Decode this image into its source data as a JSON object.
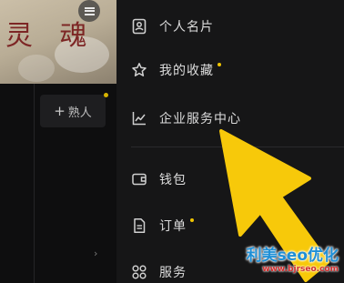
{
  "left_pane": {
    "cover_text": "灵 魂",
    "add_friend_plus": "+",
    "add_friend_label": "熟人",
    "chevron": "›"
  },
  "drawer": {
    "items": [
      {
        "label": "个人名片",
        "icon": "id-card-icon",
        "dot": false
      },
      {
        "label": "我的收藏",
        "icon": "star-icon",
        "dot": true
      },
      {
        "label": "企业服务中心",
        "icon": "chart-icon",
        "dot": false
      },
      {
        "label": "钱包",
        "icon": "wallet-icon",
        "dot": false
      },
      {
        "label": "订单",
        "icon": "order-icon",
        "dot": true
      },
      {
        "label": "服务",
        "icon": "services-icon",
        "dot": false
      }
    ]
  },
  "watermark": {
    "title": "利美seo优化",
    "url": "www.bjrseo.com"
  },
  "colors": {
    "drawer_bg": "#161617",
    "text": "#dcdcdc",
    "accent_yellow": "#f0c400",
    "arrow_yellow": "#f7c90a",
    "watermark_blue": "#1e8fd6",
    "watermark_red": "#d22d2d"
  }
}
